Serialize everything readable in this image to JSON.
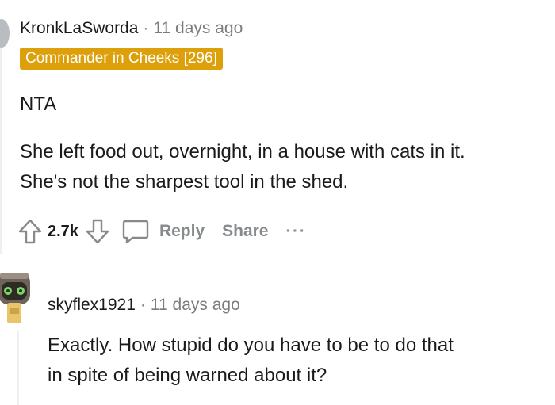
{
  "comment": {
    "username": "KronkLaSworda",
    "separator": "·",
    "time": "11 days ago",
    "flair": "Commander in Cheeks [296]",
    "paragraphs": [
      "NTA",
      "She left food out, overnight, in a house with cats in it.",
      "She's not the sharpest tool in the shed."
    ],
    "score": "2.7k",
    "reply_label": "Reply",
    "share_label": "Share",
    "more_label": "···"
  },
  "reply": {
    "username": "skyflex1921",
    "separator": "·",
    "time": "11 days ago",
    "lines": [
      "Exactly. How stupid do you have to be to do that",
      "in spite of being warned about it?"
    ]
  },
  "colors": {
    "flair_bg": "#dda00a",
    "muted": "#878a8c",
    "text": "#1a1a1b"
  }
}
